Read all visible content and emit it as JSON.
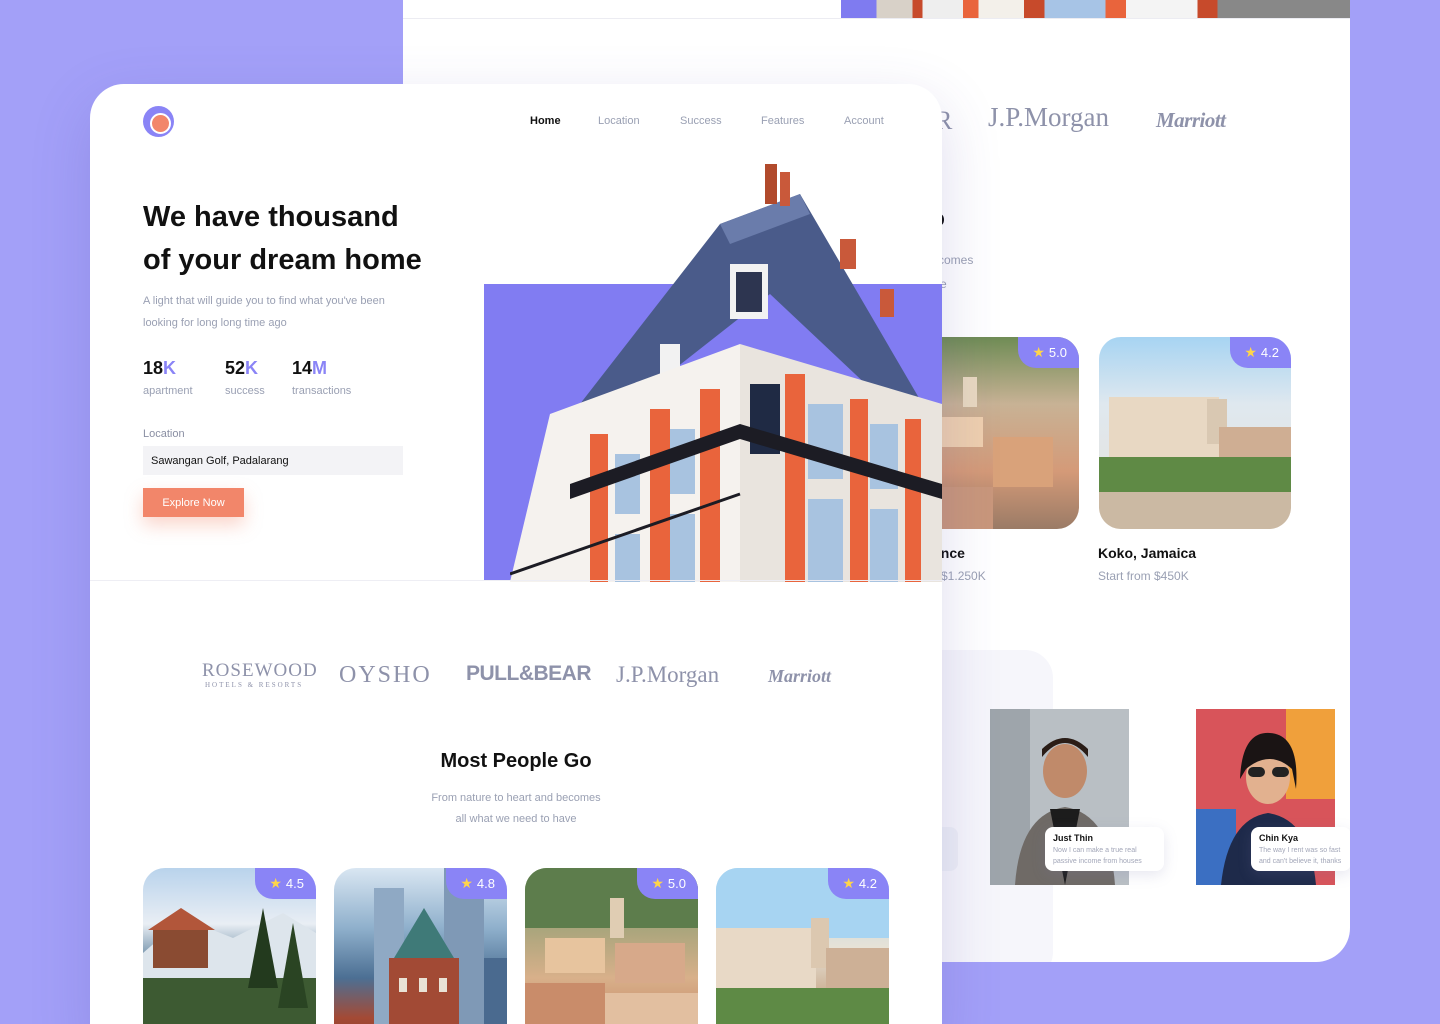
{
  "back_window": {
    "partner_logos": [
      "J.P.Morgan",
      "Marriott"
    ],
    "partial_rosewood": "R",
    "section_title_partial": "Go",
    "section_sub_partial_1": "comes",
    "section_sub_partial_2": "e",
    "cards": [
      {
        "rating": "5.0",
        "name_partial": "ance",
        "price_partial": "n $1.250K"
      },
      {
        "rating": "4.2",
        "name": "Koko, Jamaica",
        "price": "Start from $450K"
      }
    ],
    "testimonials": [
      {
        "name": "Just Thin",
        "quote": "Now I can make a true real passive income from houses"
      },
      {
        "name": "Chin Kya",
        "quote": "The way I rent was so fast and can't believe it, thanks"
      }
    ]
  },
  "nav": {
    "items": [
      "Home",
      "Location",
      "Success",
      "Features",
      "Account"
    ],
    "active": "Home"
  },
  "hero": {
    "title_line1": "We have thousand",
    "title_line2": "of your dream home",
    "subtitle": "A light that will guide you to find what you've been looking for long long time ago",
    "stats": [
      {
        "value": "18",
        "unit": "K",
        "label": "apartment"
      },
      {
        "value": "52",
        "unit": "K",
        "label": "success"
      },
      {
        "value": "14",
        "unit": "M",
        "label": "transactions"
      }
    ],
    "location_label": "Location",
    "location_value": "Sawangan Golf, Padalarang",
    "cta": "Explore Now"
  },
  "partners": {
    "rosewood": "ROSEWOOD",
    "rosewood_sub": "HOTELS & RESORTS",
    "oysho": "OYSHO",
    "pullbear": "PULL&BEAR",
    "jpmorgan": "J.P.Morgan",
    "marriott": "Marriott"
  },
  "most_people_go": {
    "title": "Most People Go",
    "subtitle_line1": "From nature to heart and becomes",
    "subtitle_line2": "all what we need to have",
    "cards": [
      {
        "rating": "4.5"
      },
      {
        "rating": "4.8"
      },
      {
        "rating": "5.0"
      },
      {
        "rating": "4.2"
      }
    ]
  },
  "colors": {
    "background": "#a3a0f8",
    "accent_purple": "#8a84f6",
    "accent_orange": "#f2866a",
    "star": "#ffd54a"
  },
  "icons": [
    "brand-logo-icon",
    "star-icon"
  ]
}
